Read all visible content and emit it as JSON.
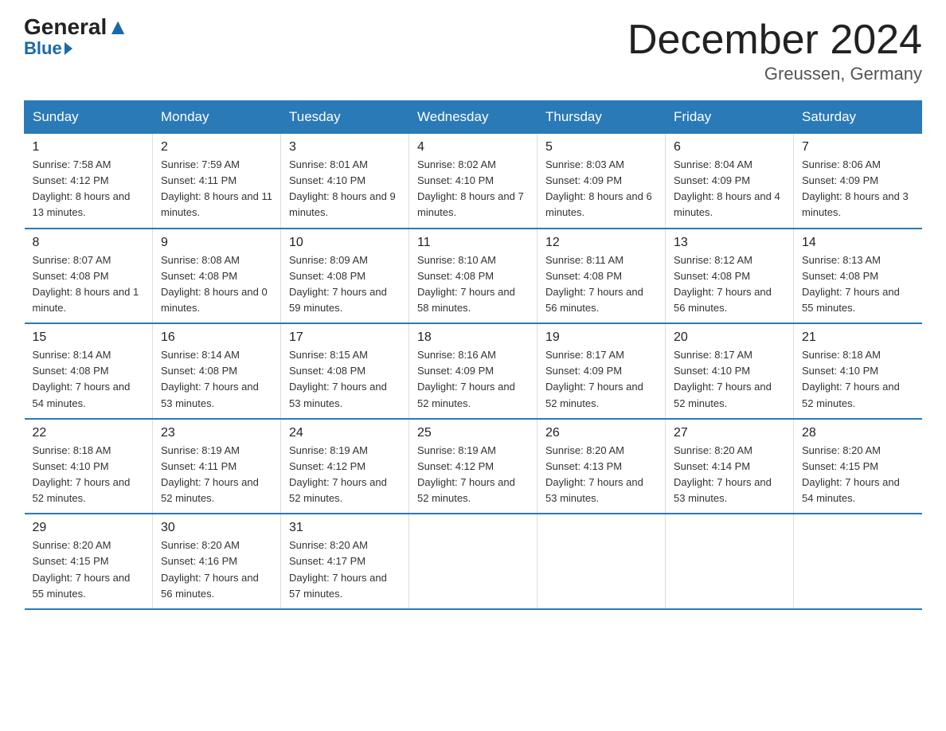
{
  "header": {
    "logo_general": "General",
    "logo_blue": "Blue",
    "month_title": "December 2024",
    "location": "Greussen, Germany"
  },
  "days_of_week": [
    "Sunday",
    "Monday",
    "Tuesday",
    "Wednesday",
    "Thursday",
    "Friday",
    "Saturday"
  ],
  "weeks": [
    [
      {
        "day": "1",
        "sunrise": "7:58 AM",
        "sunset": "4:12 PM",
        "daylight": "8 hours and 13 minutes."
      },
      {
        "day": "2",
        "sunrise": "7:59 AM",
        "sunset": "4:11 PM",
        "daylight": "8 hours and 11 minutes."
      },
      {
        "day": "3",
        "sunrise": "8:01 AM",
        "sunset": "4:10 PM",
        "daylight": "8 hours and 9 minutes."
      },
      {
        "day": "4",
        "sunrise": "8:02 AM",
        "sunset": "4:10 PM",
        "daylight": "8 hours and 7 minutes."
      },
      {
        "day": "5",
        "sunrise": "8:03 AM",
        "sunset": "4:09 PM",
        "daylight": "8 hours and 6 minutes."
      },
      {
        "day": "6",
        "sunrise": "8:04 AM",
        "sunset": "4:09 PM",
        "daylight": "8 hours and 4 minutes."
      },
      {
        "day": "7",
        "sunrise": "8:06 AM",
        "sunset": "4:09 PM",
        "daylight": "8 hours and 3 minutes."
      }
    ],
    [
      {
        "day": "8",
        "sunrise": "8:07 AM",
        "sunset": "4:08 PM",
        "daylight": "8 hours and 1 minute."
      },
      {
        "day": "9",
        "sunrise": "8:08 AM",
        "sunset": "4:08 PM",
        "daylight": "8 hours and 0 minutes."
      },
      {
        "day": "10",
        "sunrise": "8:09 AM",
        "sunset": "4:08 PM",
        "daylight": "7 hours and 59 minutes."
      },
      {
        "day": "11",
        "sunrise": "8:10 AM",
        "sunset": "4:08 PM",
        "daylight": "7 hours and 58 minutes."
      },
      {
        "day": "12",
        "sunrise": "8:11 AM",
        "sunset": "4:08 PM",
        "daylight": "7 hours and 56 minutes."
      },
      {
        "day": "13",
        "sunrise": "8:12 AM",
        "sunset": "4:08 PM",
        "daylight": "7 hours and 56 minutes."
      },
      {
        "day": "14",
        "sunrise": "8:13 AM",
        "sunset": "4:08 PM",
        "daylight": "7 hours and 55 minutes."
      }
    ],
    [
      {
        "day": "15",
        "sunrise": "8:14 AM",
        "sunset": "4:08 PM",
        "daylight": "7 hours and 54 minutes."
      },
      {
        "day": "16",
        "sunrise": "8:14 AM",
        "sunset": "4:08 PM",
        "daylight": "7 hours and 53 minutes."
      },
      {
        "day": "17",
        "sunrise": "8:15 AM",
        "sunset": "4:08 PM",
        "daylight": "7 hours and 53 minutes."
      },
      {
        "day": "18",
        "sunrise": "8:16 AM",
        "sunset": "4:09 PM",
        "daylight": "7 hours and 52 minutes."
      },
      {
        "day": "19",
        "sunrise": "8:17 AM",
        "sunset": "4:09 PM",
        "daylight": "7 hours and 52 minutes."
      },
      {
        "day": "20",
        "sunrise": "8:17 AM",
        "sunset": "4:10 PM",
        "daylight": "7 hours and 52 minutes."
      },
      {
        "day": "21",
        "sunrise": "8:18 AM",
        "sunset": "4:10 PM",
        "daylight": "7 hours and 52 minutes."
      }
    ],
    [
      {
        "day": "22",
        "sunrise": "8:18 AM",
        "sunset": "4:10 PM",
        "daylight": "7 hours and 52 minutes."
      },
      {
        "day": "23",
        "sunrise": "8:19 AM",
        "sunset": "4:11 PM",
        "daylight": "7 hours and 52 minutes."
      },
      {
        "day": "24",
        "sunrise": "8:19 AM",
        "sunset": "4:12 PM",
        "daylight": "7 hours and 52 minutes."
      },
      {
        "day": "25",
        "sunrise": "8:19 AM",
        "sunset": "4:12 PM",
        "daylight": "7 hours and 52 minutes."
      },
      {
        "day": "26",
        "sunrise": "8:20 AM",
        "sunset": "4:13 PM",
        "daylight": "7 hours and 53 minutes."
      },
      {
        "day": "27",
        "sunrise": "8:20 AM",
        "sunset": "4:14 PM",
        "daylight": "7 hours and 53 minutes."
      },
      {
        "day": "28",
        "sunrise": "8:20 AM",
        "sunset": "4:15 PM",
        "daylight": "7 hours and 54 minutes."
      }
    ],
    [
      {
        "day": "29",
        "sunrise": "8:20 AM",
        "sunset": "4:15 PM",
        "daylight": "7 hours and 55 minutes."
      },
      {
        "day": "30",
        "sunrise": "8:20 AM",
        "sunset": "4:16 PM",
        "daylight": "7 hours and 56 minutes."
      },
      {
        "day": "31",
        "sunrise": "8:20 AM",
        "sunset": "4:17 PM",
        "daylight": "7 hours and 57 minutes."
      },
      null,
      null,
      null,
      null
    ]
  ]
}
